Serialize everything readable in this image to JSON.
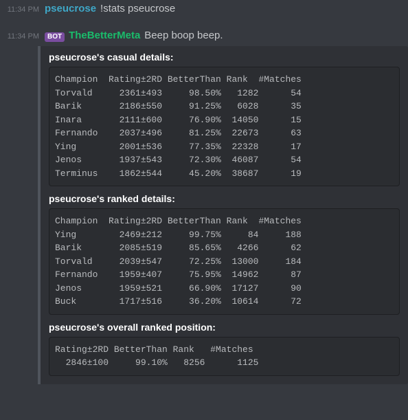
{
  "messages": {
    "user": {
      "timestamp": "11:34 PM",
      "username": "pseucrose",
      "username_color": "u-blue",
      "text": "!stats pseucrose"
    },
    "bot": {
      "timestamp": "11:34 PM",
      "bot_tag": "BOT",
      "username": "TheBetterMeta",
      "username_color": "u-green",
      "text": "Beep boop beep."
    }
  },
  "embed": {
    "sections": [
      {
        "title": "pseucrose's casual details:",
        "columns": [
          "Champion",
          "Rating±2RD",
          "BetterThan",
          "Rank",
          "#Matches"
        ],
        "rows": [
          {
            "champion": "Torvald",
            "rating": "2361±493",
            "better": "98.50%",
            "rank": "1282",
            "matches": "54"
          },
          {
            "champion": "Barik",
            "rating": "2186±550",
            "better": "91.25%",
            "rank": "6028",
            "matches": "35"
          },
          {
            "champion": "Inara",
            "rating": "2111±600",
            "better": "76.90%",
            "rank": "14050",
            "matches": "15"
          },
          {
            "champion": "Fernando",
            "rating": "2037±496",
            "better": "81.25%",
            "rank": "22673",
            "matches": "63"
          },
          {
            "champion": "Ying",
            "rating": "2001±536",
            "better": "77.35%",
            "rank": "22328",
            "matches": "17"
          },
          {
            "champion": "Jenos",
            "rating": "1937±543",
            "better": "72.30%",
            "rank": "46087",
            "matches": "54"
          },
          {
            "champion": "Terminus",
            "rating": "1862±544",
            "better": "45.20%",
            "rank": "38687",
            "matches": "19"
          }
        ]
      },
      {
        "title": "pseucrose's ranked details:",
        "columns": [
          "Champion",
          "Rating±2RD",
          "BetterThan",
          "Rank",
          "#Matches"
        ],
        "rows": [
          {
            "champion": "Ying",
            "rating": "2469±212",
            "better": "99.75%",
            "rank": "84",
            "matches": "188"
          },
          {
            "champion": "Barik",
            "rating": "2085±519",
            "better": "85.65%",
            "rank": "4266",
            "matches": "62"
          },
          {
            "champion": "Torvald",
            "rating": "2039±547",
            "better": "72.25%",
            "rank": "13000",
            "matches": "184"
          },
          {
            "champion": "Fernando",
            "rating": "1959±407",
            "better": "75.95%",
            "rank": "14962",
            "matches": "87"
          },
          {
            "champion": "Jenos",
            "rating": "1959±521",
            "better": "66.90%",
            "rank": "17127",
            "matches": "90"
          },
          {
            "champion": "Buck",
            "rating": "1717±516",
            "better": "36.20%",
            "rank": "10614",
            "matches": "72"
          }
        ]
      },
      {
        "title": "pseucrose's overall ranked position:",
        "columns": [
          "Rating±2RD",
          "BetterThan",
          "Rank",
          "#Matches"
        ],
        "overall": {
          "rating": "2846±100",
          "better": "99.10%",
          "rank": "8256",
          "matches": "1125"
        }
      }
    ]
  }
}
